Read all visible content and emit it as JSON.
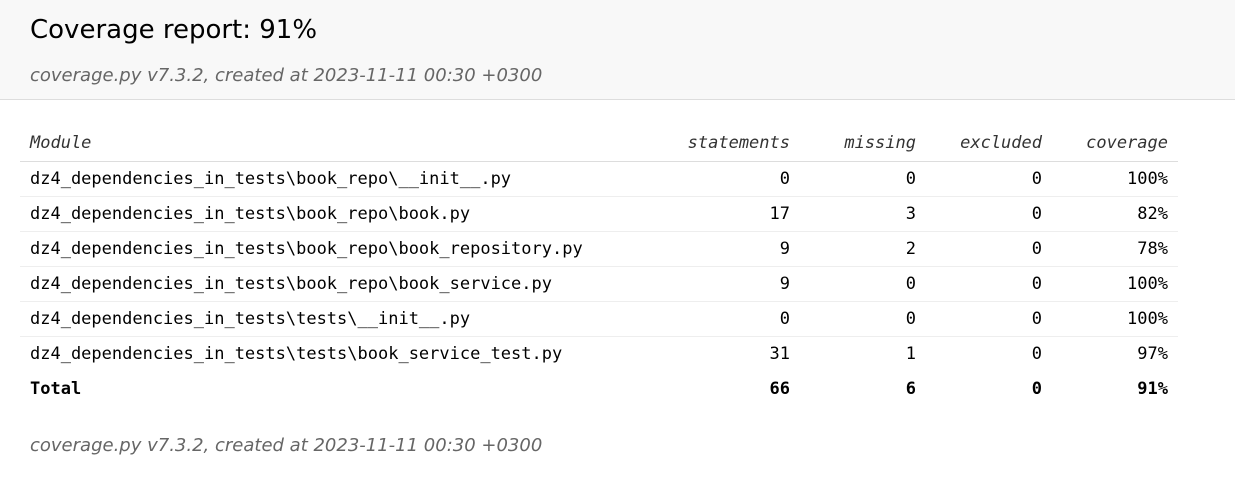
{
  "header": {
    "title": "Coverage report: 91%",
    "subtitle": "coverage.py v7.3.2, created at 2023-11-11 00:30 +0300"
  },
  "table": {
    "columns": [
      "Module",
      "statements",
      "missing",
      "excluded",
      "coverage"
    ],
    "rows": [
      {
        "module": "dz4_dependencies_in_tests\\book_repo\\__init__.py",
        "statements": "0",
        "missing": "0",
        "excluded": "0",
        "coverage": "100%"
      },
      {
        "module": "dz4_dependencies_in_tests\\book_repo\\book.py",
        "statements": "17",
        "missing": "3",
        "excluded": "0",
        "coverage": "82%"
      },
      {
        "module": "dz4_dependencies_in_tests\\book_repo\\book_repository.py",
        "statements": "9",
        "missing": "2",
        "excluded": "0",
        "coverage": "78%"
      },
      {
        "module": "dz4_dependencies_in_tests\\book_repo\\book_service.py",
        "statements": "9",
        "missing": "0",
        "excluded": "0",
        "coverage": "100%"
      },
      {
        "module": "dz4_dependencies_in_tests\\tests\\__init__.py",
        "statements": "0",
        "missing": "0",
        "excluded": "0",
        "coverage": "100%"
      },
      {
        "module": "dz4_dependencies_in_tests\\tests\\book_service_test.py",
        "statements": "31",
        "missing": "1",
        "excluded": "0",
        "coverage": "97%"
      }
    ],
    "total": {
      "label": "Total",
      "statements": "66",
      "missing": "6",
      "excluded": "0",
      "coverage": "91%"
    }
  },
  "footer": {
    "text": "coverage.py v7.3.2, created at 2023-11-11 00:30 +0300"
  }
}
